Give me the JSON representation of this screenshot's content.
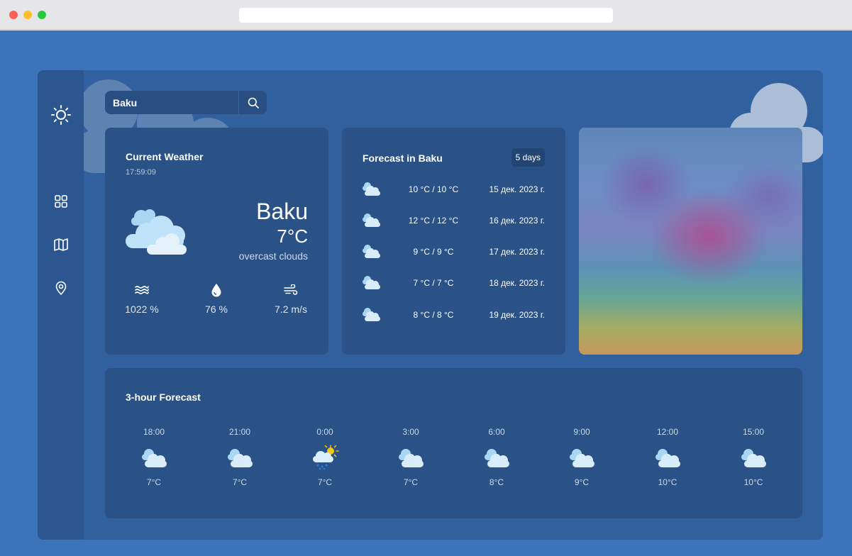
{
  "search": {
    "value": "Baku"
  },
  "current": {
    "title": "Current Weather",
    "time": "17:59:09",
    "city": "Baku",
    "temp": "7°C",
    "description": "overcast clouds",
    "icon": "overcast-clouds-icon",
    "stats": [
      {
        "icon": "pressure-icon",
        "value": "1022 %"
      },
      {
        "icon": "humidity-icon",
        "value": "76 %"
      },
      {
        "icon": "wind-icon",
        "value": "7.2 m/s"
      }
    ]
  },
  "forecast": {
    "title": "Forecast in Baku",
    "badge": "5 days",
    "rows": [
      {
        "icon": "cloudy-icon",
        "temp": "10 °C / 10 °C",
        "date": "15 дек. 2023 г."
      },
      {
        "icon": "cloudy-icon",
        "temp": "12 °C / 12 °C",
        "date": "16 дек. 2023 г."
      },
      {
        "icon": "cloudy-icon",
        "temp": "9 °C / 9 °C",
        "date": "17 дек. 2023 г."
      },
      {
        "icon": "cloudy-icon",
        "temp": "7 °C / 7 °C",
        "date": "18 дек. 2023 г."
      },
      {
        "icon": "cloudy-icon",
        "temp": "8 °C / 8 °C",
        "date": "19 дек. 2023 г."
      }
    ]
  },
  "hourly": {
    "title": "3-hour Forecast",
    "items": [
      {
        "time": "18:00",
        "temp": "7°C",
        "icon": "cloudy-icon"
      },
      {
        "time": "21:00",
        "temp": "7°C",
        "icon": "cloudy-icon"
      },
      {
        "time": "0:00",
        "temp": "7°C",
        "icon": "sun-rain-icon"
      },
      {
        "time": "3:00",
        "temp": "7°C",
        "icon": "cloudy-icon"
      },
      {
        "time": "6:00",
        "temp": "8°C",
        "icon": "cloudy-icon"
      },
      {
        "time": "9:00",
        "temp": "9°C",
        "icon": "cloudy-icon"
      },
      {
        "time": "12:00",
        "temp": "10°C",
        "icon": "cloudy-icon"
      },
      {
        "time": "15:00",
        "temp": "10°C",
        "icon": "cloudy-icon"
      }
    ]
  },
  "sidebar": {
    "items": [
      {
        "icon": "sun-icon"
      },
      {
        "icon": "grid-icon"
      },
      {
        "icon": "map-icon"
      },
      {
        "icon": "location-pin-icon"
      }
    ]
  },
  "colors": {
    "background": "#3d73bb",
    "app": "#31609e",
    "sidebar": "#2c5690",
    "card": "#2a5286"
  }
}
